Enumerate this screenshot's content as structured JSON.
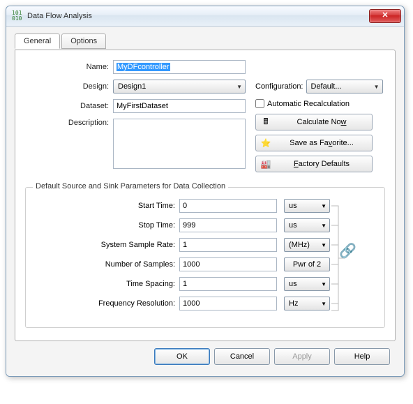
{
  "window": {
    "title": "Data Flow Analysis",
    "close_label": "✕"
  },
  "tabs": {
    "general": "General",
    "options": "Options"
  },
  "form": {
    "name_label": "Name:",
    "name_value": "MyDFcontroller",
    "design_label": "Design:",
    "design_value": "Design1",
    "dataset_label": "Dataset:",
    "dataset_value": "MyFirstDataset",
    "description_label": "Description:",
    "description_value": ""
  },
  "config": {
    "label": "Configuration:",
    "value": "Default...",
    "auto_recalc_label": "Automatic Recalculation",
    "auto_recalc_checked": false
  },
  "buttons": {
    "calc_now": "Calculate Now",
    "save_fav": "Save as Favorite...",
    "factory": "Factory Defaults"
  },
  "fieldset": {
    "legend": "Default Source and Sink Parameters for Data Collection",
    "rows": [
      {
        "label": "Start Time:",
        "value": "0",
        "unit": "us",
        "unit_type": "dd"
      },
      {
        "label": "Stop Time:",
        "value": "999",
        "unit": "us",
        "unit_type": "dd"
      },
      {
        "label": "System Sample Rate:",
        "value": "1",
        "unit": "(MHz)",
        "unit_type": "dd"
      },
      {
        "label": "Number of Samples:",
        "value": "1000",
        "unit": "Pwr of 2",
        "unit_type": "btn"
      },
      {
        "label": "Time Spacing:",
        "value": "1",
        "unit": "us",
        "unit_type": "dd"
      },
      {
        "label": "Frequency Resolution:",
        "value": "1000",
        "unit": "Hz",
        "unit_type": "dd"
      }
    ]
  },
  "dialog_buttons": {
    "ok": "OK",
    "cancel": "Cancel",
    "apply": "Apply",
    "help": "Help"
  }
}
